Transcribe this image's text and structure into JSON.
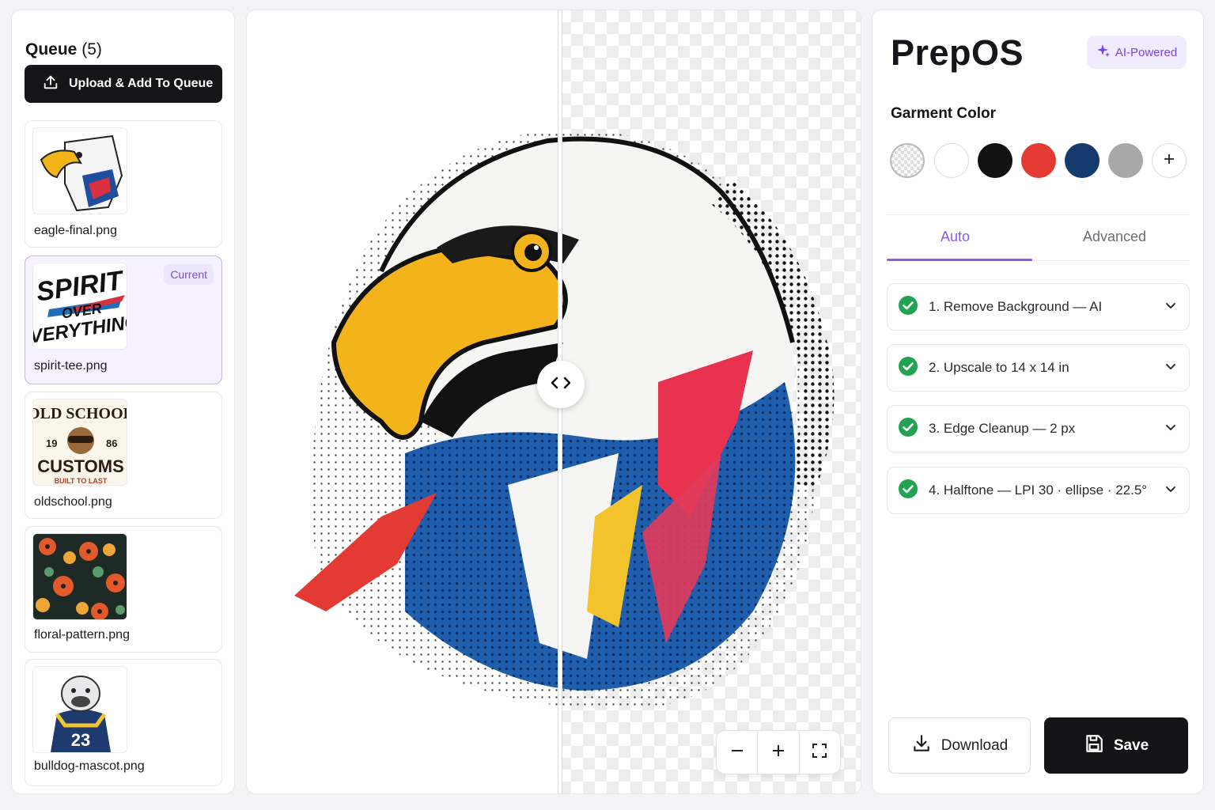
{
  "queue": {
    "title": "Queue",
    "count": "(5)",
    "upload_label": "Upload & Add To Queue",
    "current_badge": "Current",
    "items": [
      {
        "name": "eagle-final.png"
      },
      {
        "name": "spirit-tee.png",
        "current": true,
        "art_text": [
          "SPIRIT",
          "OVER",
          "EVERYTHING"
        ]
      },
      {
        "name": "oldschool.png",
        "art_text": [
          "OLD SCHOOL",
          "19",
          "86",
          "CUSTOMS",
          "BUILT TO LAST"
        ]
      },
      {
        "name": "floral-pattern.png"
      },
      {
        "name": "bulldog-mascot.png",
        "art_text": [
          "23"
        ]
      }
    ]
  },
  "canvas": {
    "zoom_out_icon": "minus-icon",
    "zoom_in_icon": "plus-icon",
    "fit_icon": "fullscreen-icon"
  },
  "settings": {
    "brand": "PrepOS",
    "ai_badge": "AI-Powered",
    "garment_label": "Garment Color",
    "swatches": [
      "transparent",
      "#ffffff",
      "#111111",
      "#e33a34",
      "#143a6e",
      "#a8a8a8"
    ],
    "add_swatch_icon": "plus-icon",
    "tabs": [
      "Auto",
      "Advanced"
    ],
    "active_tab": "Auto",
    "steps": [
      "1. Remove Background — AI",
      "2. Upscale to 14 x 14 in",
      "3. Edge Cleanup — 2 px",
      "4. Halftone — LPI 30 · ellipse · 22.5°"
    ],
    "download_label": "Download",
    "save_label": "Save"
  },
  "colors": {
    "accent": "#8f5ae8",
    "check": "#22a352",
    "dark": "#141417"
  }
}
